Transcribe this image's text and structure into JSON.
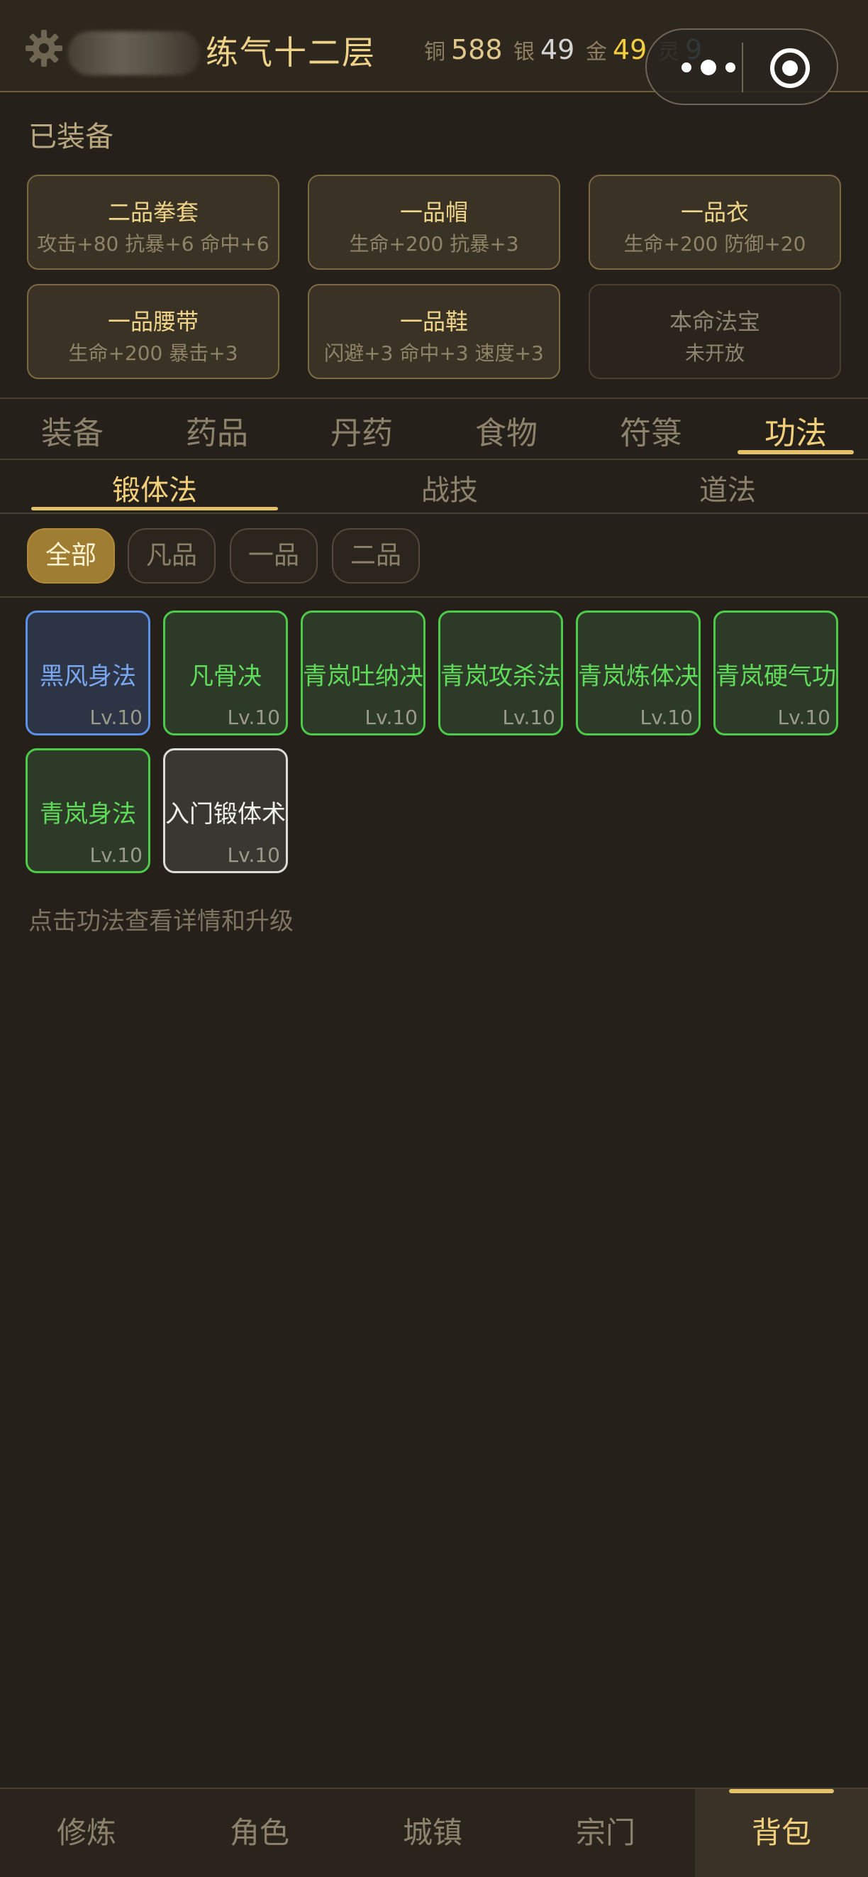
{
  "header": {
    "realm": "练气十二层",
    "currencies": [
      {
        "label": "铜",
        "value": "588",
        "color": "#e0c78c"
      },
      {
        "label": "银",
        "value": "49",
        "color": "#d4d4d4"
      },
      {
        "label": "金",
        "value": "49",
        "color": "#f2cd42"
      },
      {
        "label": "灵",
        "value": "9",
        "color": "#57b3c7"
      }
    ]
  },
  "equipped": {
    "title": "已装备",
    "slots": [
      {
        "name": "二品拳套",
        "stats": "攻击+80 抗暴+6 命中+6"
      },
      {
        "name": "一品帽",
        "stats": "生命+200 抗暴+3"
      },
      {
        "name": "一品衣",
        "stats": "生命+200 防御+20"
      },
      {
        "name": "一品腰带",
        "stats": "生命+200 暴击+3"
      },
      {
        "name": "一品鞋",
        "stats": "闪避+3 命中+3 速度+3"
      },
      {
        "name": "本命法宝",
        "stats": "未开放"
      }
    ]
  },
  "tabs": [
    "装备",
    "药品",
    "丹药",
    "食物",
    "符箓",
    "功法"
  ],
  "active_tab": "功法",
  "subtabs": [
    "锻体法",
    "战技",
    "道法"
  ],
  "active_subtab": "锻体法",
  "filters": [
    "全部",
    "凡品",
    "一品",
    "二品"
  ],
  "active_filter": "全部",
  "skills": [
    {
      "name": "黑风身法",
      "level": "Lv.10",
      "grade": "blue"
    },
    {
      "name": "凡骨决",
      "level": "Lv.10",
      "grade": "green"
    },
    {
      "name": "青岚吐纳决",
      "level": "Lv.10",
      "grade": "green"
    },
    {
      "name": "青岚攻杀法",
      "level": "Lv.10",
      "grade": "green"
    },
    {
      "name": "青岚炼体决",
      "level": "Lv.10",
      "grade": "green"
    },
    {
      "name": "青岚硬气功",
      "level": "Lv.10",
      "grade": "green"
    },
    {
      "name": "青岚身法",
      "level": "Lv.10",
      "grade": "green"
    },
    {
      "name": "入门锻体术",
      "level": "Lv.10",
      "grade": "white"
    }
  ],
  "hint": "点击功法查看详情和升级",
  "bottom_nav": [
    "修炼",
    "角色",
    "城镇",
    "宗门",
    "背包"
  ],
  "active_nav": "背包",
  "icons": {
    "settings": "gear-icon",
    "more": "more-dots-icon",
    "close": "capsule-close-icon"
  }
}
